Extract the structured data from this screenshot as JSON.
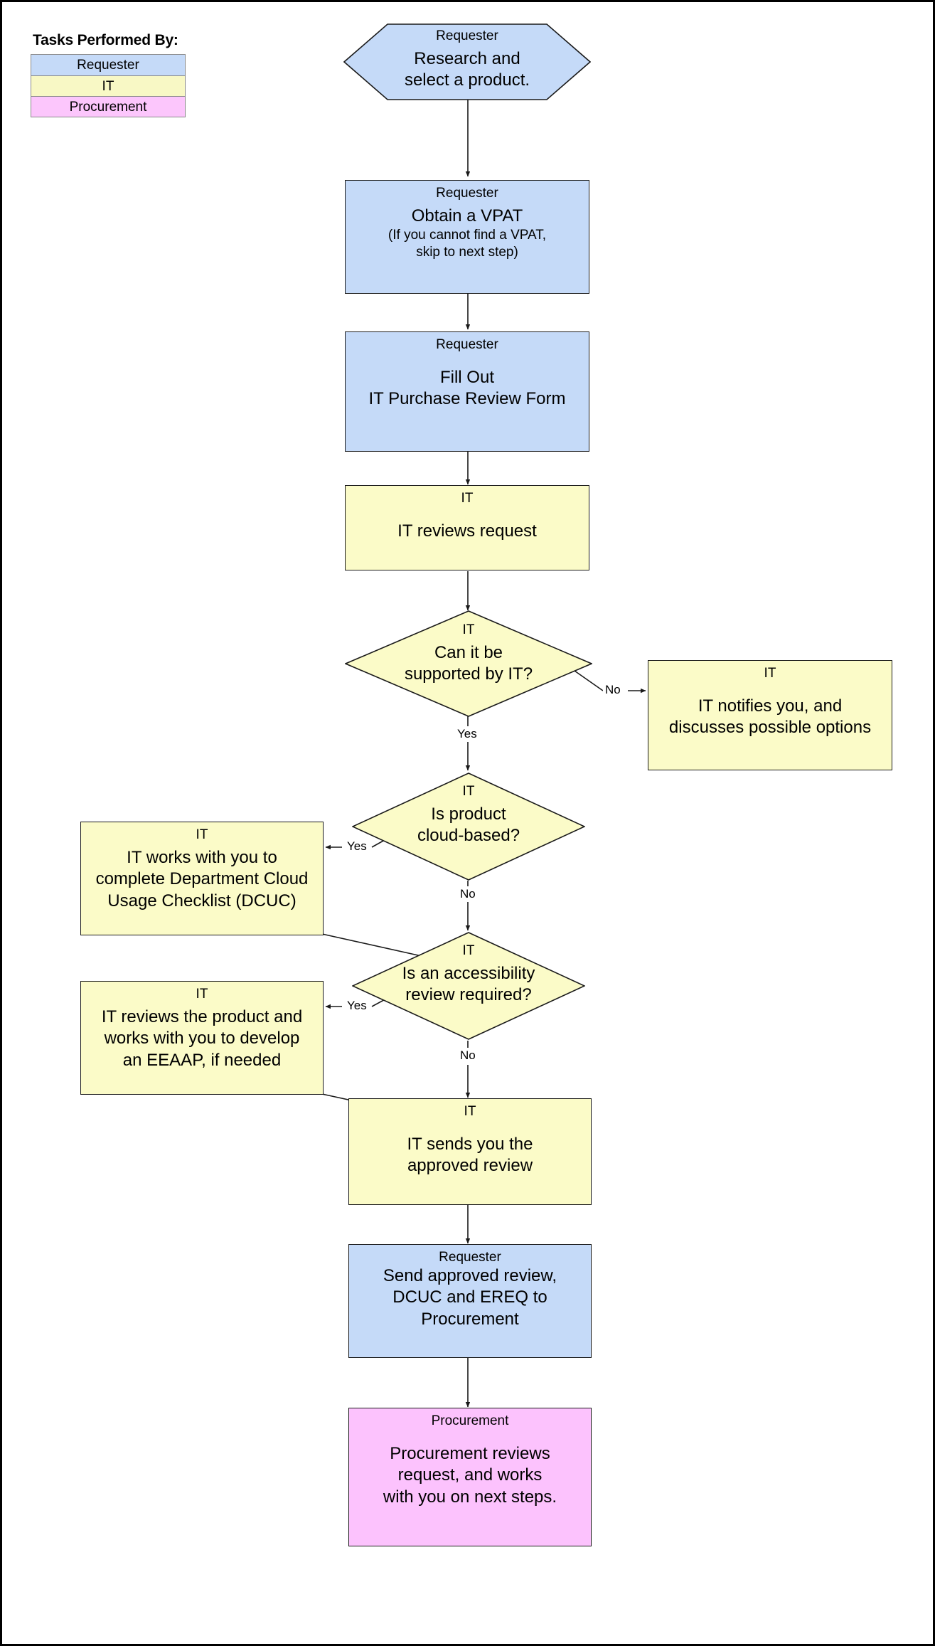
{
  "legend": {
    "title": "Tasks Performed By:",
    "items": [
      {
        "label": "Requester",
        "color": "#c5daf8"
      },
      {
        "label": "IT",
        "color": "#f8f8c5"
      },
      {
        "label": "Procurement",
        "color": "#fcc6fc"
      }
    ]
  },
  "colors": {
    "requester": "#c5daf8",
    "it": "#fbfbc8",
    "procurement": "#fcc2fd",
    "stroke": "#1a1a1a",
    "background": "#ffffff"
  },
  "nodes": {
    "research": {
      "role": "Requester",
      "line1": "Research and",
      "line2": "select a product.",
      "shape": "hexagon",
      "owner": "Requester"
    },
    "vpat": {
      "role": "Requester",
      "line1": "Obtain a VPAT",
      "line2": "(If you cannot find a VPAT,",
      "line3": "skip to next step)",
      "shape": "rectangle",
      "owner": "Requester"
    },
    "fill_form": {
      "role": "Requester",
      "line1": "Fill Out",
      "line2": "IT Purchase Review Form",
      "shape": "rectangle",
      "owner": "Requester"
    },
    "it_reviews": {
      "role": "IT",
      "line1": "IT reviews request",
      "shape": "rectangle",
      "owner": "IT"
    },
    "supported": {
      "role": "IT",
      "line1": "Can it be",
      "line2": "supported by IT?",
      "shape": "diamond",
      "owner": "IT"
    },
    "it_notifies": {
      "role": "IT",
      "line1": "IT notifies you, and",
      "line2": "discusses possible options",
      "shape": "rectangle",
      "owner": "IT"
    },
    "cloud_based": {
      "role": "IT",
      "line1": "Is product",
      "line2": "cloud-based?",
      "shape": "diamond",
      "owner": "IT"
    },
    "dcuc": {
      "role": "IT",
      "line1": "IT works with you to",
      "line2": "complete Department Cloud",
      "line3": "Usage Checklist (DCUC)",
      "shape": "rectangle",
      "owner": "IT"
    },
    "accessibility": {
      "role": "IT",
      "line1": "Is an accessibility",
      "line2": "review required?",
      "shape": "diamond",
      "owner": "IT"
    },
    "eeaap": {
      "role": "IT",
      "line1": "IT reviews the product and",
      "line2": "works with you to develop",
      "line3": "an EEAAP, if needed",
      "shape": "rectangle",
      "owner": "IT"
    },
    "approved_review": {
      "role": "IT",
      "line1": "IT sends you the",
      "line2": "approved review",
      "shape": "rectangle",
      "owner": "IT"
    },
    "send_to_proc": {
      "role": "Requester",
      "line1": "Send approved review,",
      "line2": "DCUC and EREQ to",
      "line3": "Procurement",
      "shape": "rectangle",
      "owner": "Requester"
    },
    "procurement": {
      "role": "Procurement",
      "line1": "Procurement reviews",
      "line2": "request, and works",
      "line3": "with you on next steps.",
      "shape": "rectangle",
      "owner": "Procurement"
    }
  },
  "edge_labels": {
    "supported_no": "No",
    "supported_yes": "Yes",
    "cloud_yes": "Yes",
    "cloud_no": "No",
    "access_yes": "Yes",
    "access_no": "No"
  }
}
